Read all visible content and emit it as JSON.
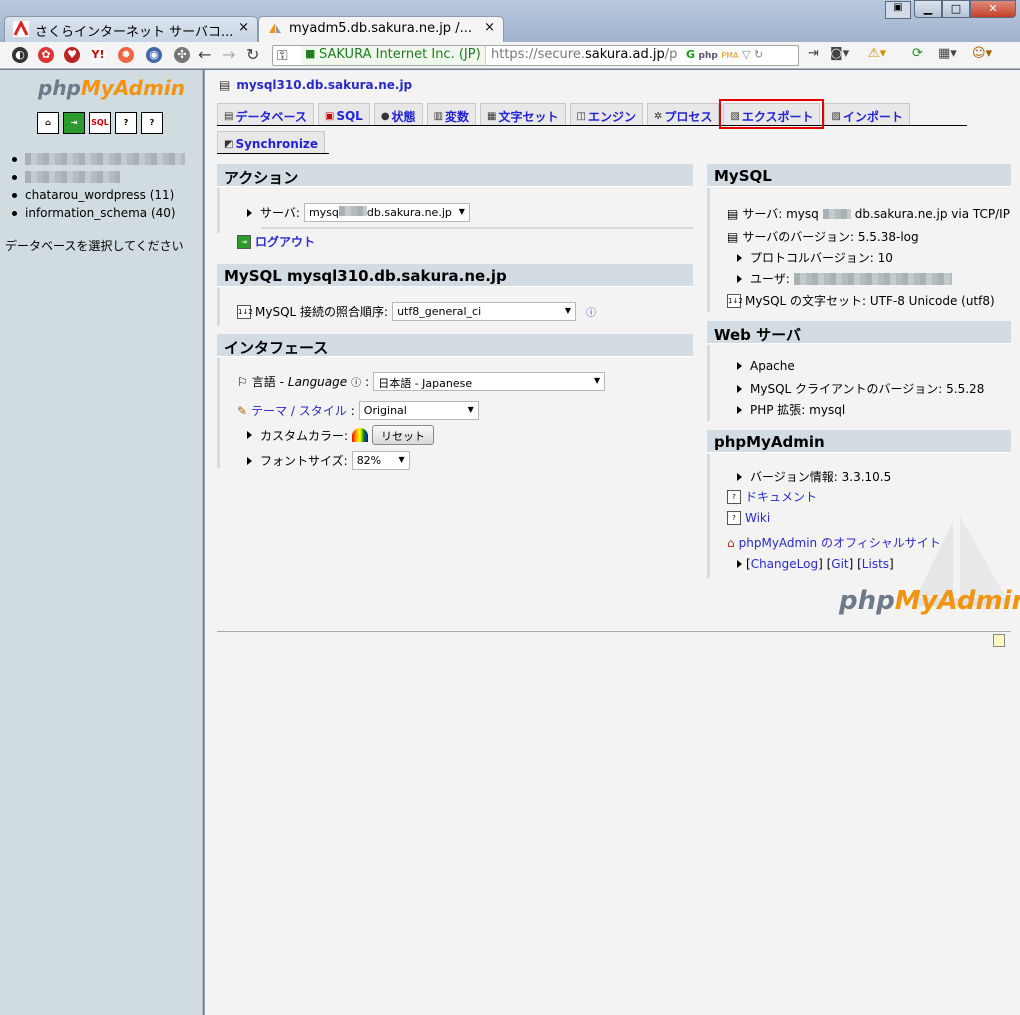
{
  "browser": {
    "tabs": [
      {
        "label": "さくらインターネット サーバコ...",
        "active": false
      },
      {
        "label": "myadm5.db.sakura.ne.jp /...",
        "active": true
      }
    ],
    "ev_label": "SAKURA Internet Inc. (JP)",
    "url_prefix": "https://secure.",
    "url_host": "sakura.ad.jp",
    "url_rest": "/p",
    "tab_close": "×",
    "ext_php_label": "php",
    "ext_pma_label": "PMA"
  },
  "sidebar": {
    "logo_php": "php",
    "logo_my": "MyAdmin",
    "icons": [
      "home",
      "Exit",
      "SQL",
      "?",
      "?"
    ],
    "databases": [
      {
        "label": "",
        "blurred": true
      },
      {
        "label": "",
        "blurred": true
      },
      {
        "label": "chatarou_wordpress (11)",
        "blurred": false
      },
      {
        "label": "information_schema (40)",
        "blurred": false
      }
    ],
    "select_db": "データベースを選択してください"
  },
  "main": {
    "server": "mysql310.db.sakura.ne.jp",
    "tabs": [
      {
        "label": "データベース",
        "highlight": false
      },
      {
        "label": "SQL",
        "highlight": false
      },
      {
        "label": "状態",
        "highlight": false
      },
      {
        "label": "変数",
        "highlight": false
      },
      {
        "label": "文字セット",
        "highlight": false
      },
      {
        "label": "エンジン",
        "highlight": false
      },
      {
        "label": "プロセス",
        "highlight": false
      },
      {
        "label": "エクスポート",
        "highlight": true
      },
      {
        "label": "インポート",
        "highlight": false
      }
    ],
    "tab_sync": "Synchronize",
    "actions": {
      "title": "アクション",
      "server_label": "サーバ:",
      "server_value_a": "mysq",
      "server_value_b": "db.sakura.ne.jp",
      "logout": "ログアウト"
    },
    "mysql_server": {
      "title": "MySQL mysql310.db.sakura.ne.jp",
      "collation_label": "MySQL 接続の照合順序:",
      "collation_value": "utf8_general_ci"
    },
    "interface": {
      "title": "インタフェース",
      "lang_label": "言語 - ",
      "lang_label_en": "Language",
      "lang_value": "日本語 - Japanese",
      "theme_link": "テーマ / スタイル",
      "theme_value": "Original",
      "color_label": "カスタムカラー:",
      "reset_button": "リセット",
      "fontsize_label": "フォントサイズ:",
      "fontsize_value": "82%"
    },
    "mysql_info": {
      "title": "MySQL",
      "server_a": "サーバ: mysq",
      "server_b": "db.sakura.ne.jp via TCP/IP",
      "version": "サーバのバージョン: 5.5.38-log",
      "protocol": "プロトコルバージョン: 10",
      "user": "ユーザ:",
      "charset": "MySQL の文字セット: UTF-8 Unicode (utf8)"
    },
    "web_server": {
      "title": "Web サーバ",
      "items": [
        "Apache",
        "MySQL クライアントのバージョン: 5.5.28",
        "PHP 拡張: mysql"
      ]
    },
    "pma": {
      "title": "phpMyAdmin",
      "version": "バージョン情報: 3.3.10.5",
      "docs": "ドキュメント",
      "wiki": "Wiki",
      "official": "phpMyAdmin のオフィシャルサイト",
      "links_open": "[",
      "changelog": "ChangeLog",
      "links_mid1": "] [",
      "git": "Git",
      "links_mid2": "] [",
      "lists": "Lists",
      "links_close": "]"
    },
    "logo_php": "php",
    "logo_my": "MyAdmin"
  }
}
